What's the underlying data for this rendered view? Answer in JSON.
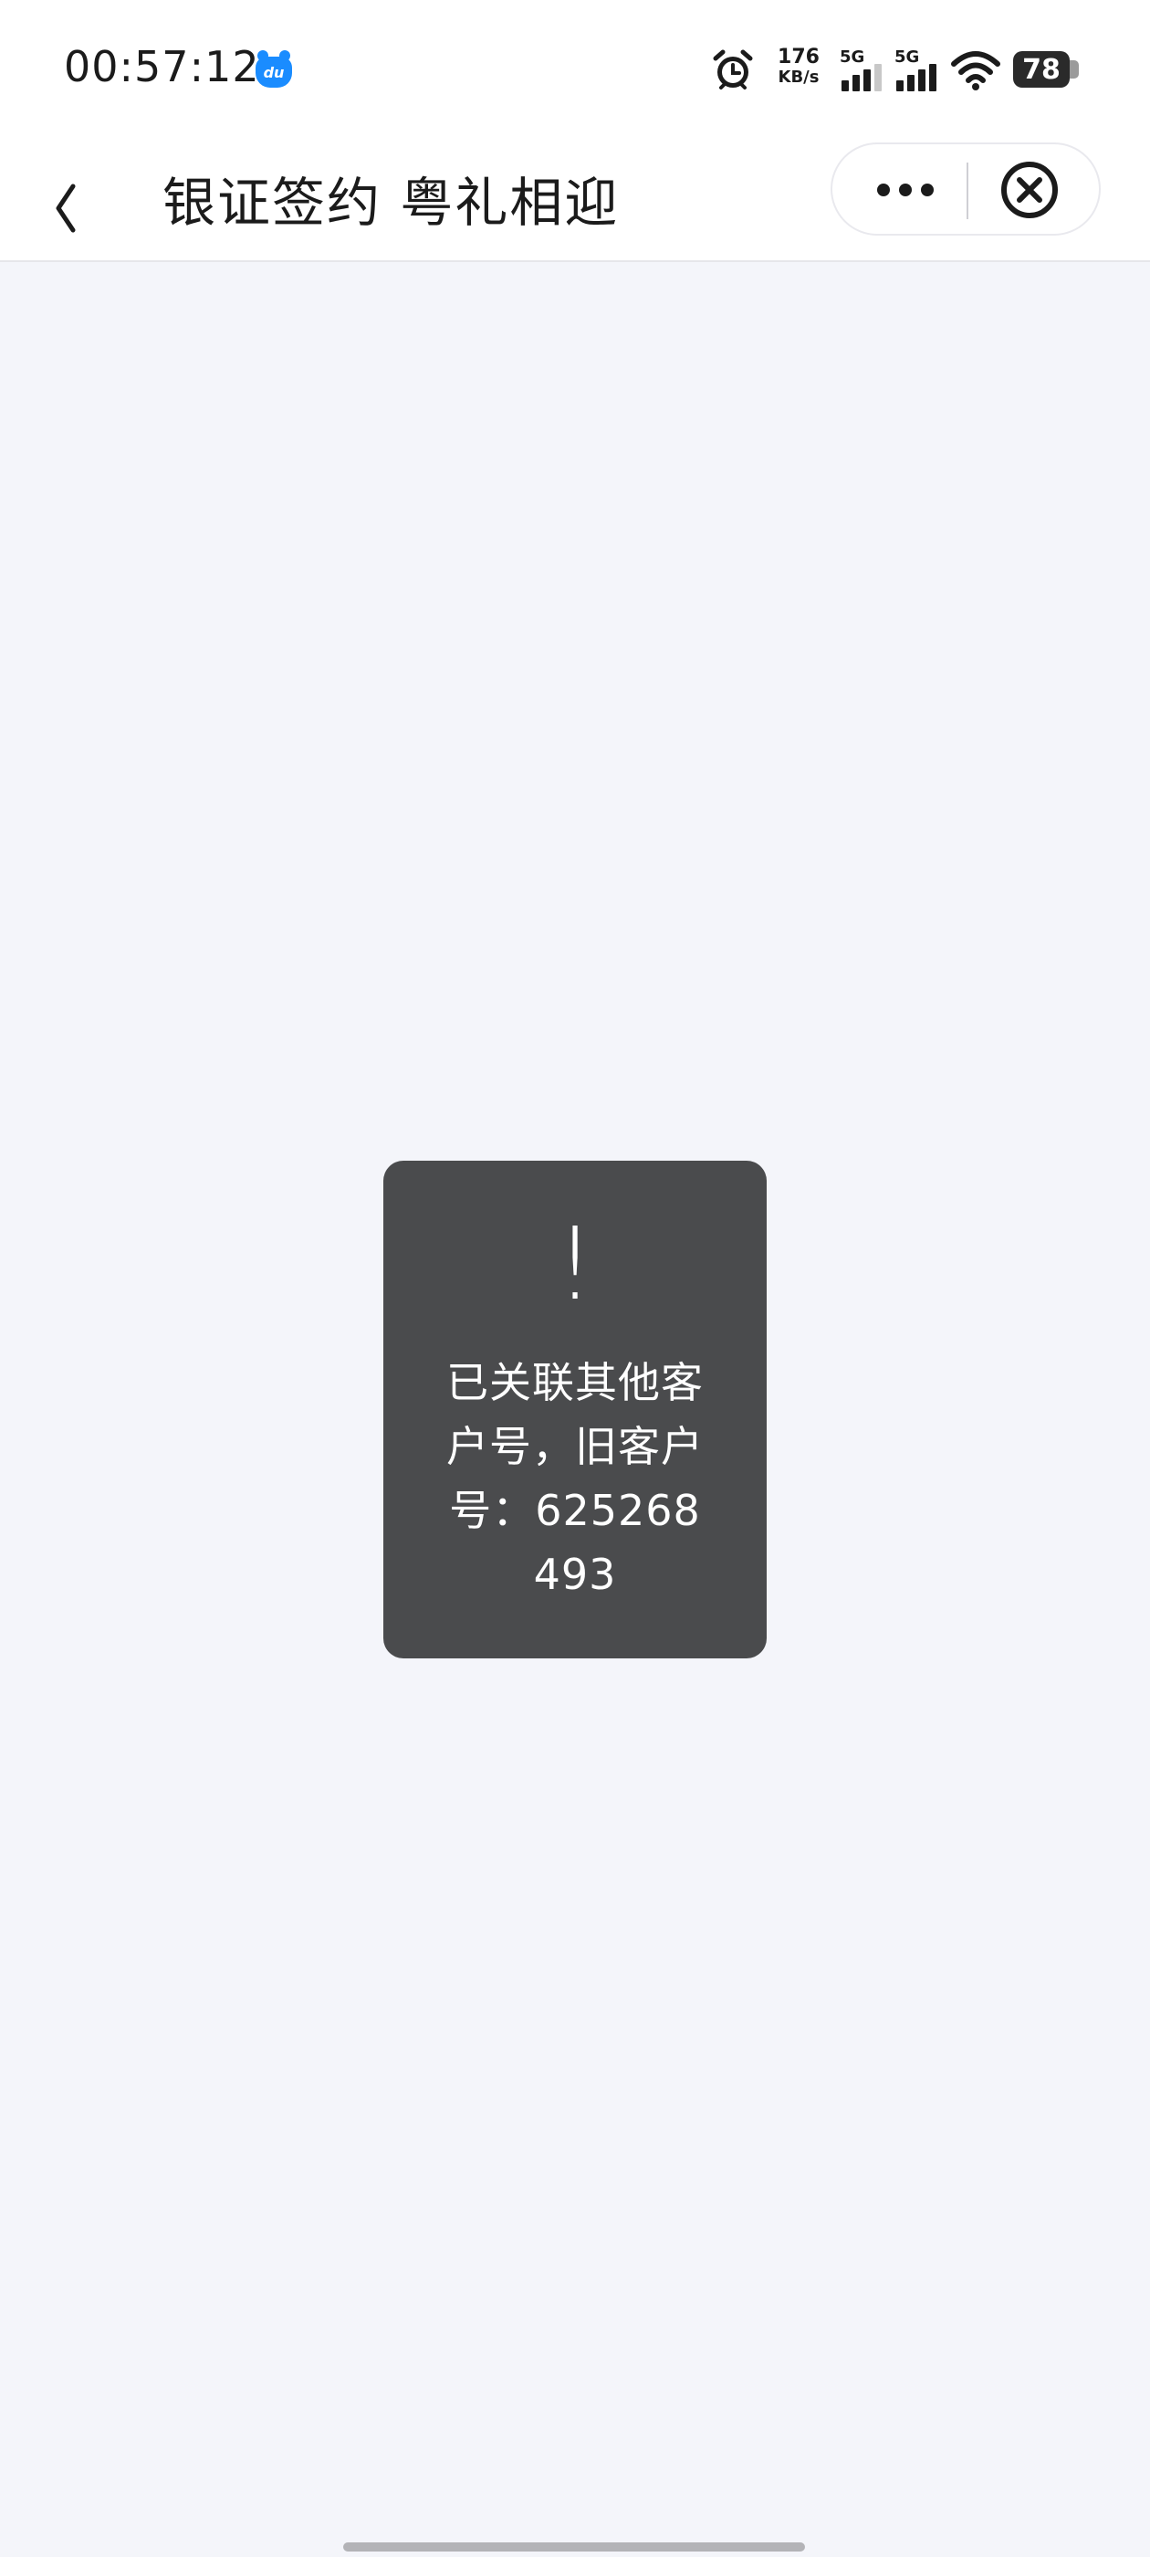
{
  "status_bar": {
    "time": "00:57:12",
    "app_badge": "du",
    "net_speed_value": "176",
    "net_speed_unit": "KB/s",
    "sim1_label": "5G",
    "sim2_label": "5G",
    "battery_level": "78"
  },
  "nav": {
    "title": "银证签约 粤礼相迎",
    "back_icon": "chevron-left-icon",
    "more_icon": "more-dots-icon",
    "close_icon": "close-circle-icon"
  },
  "toast": {
    "icon": "!",
    "message": "已关联其他客户号，旧客户号：625268493"
  },
  "colors": {
    "page_background": "#f4f5fa",
    "toast_background": "#4a4b4d",
    "badge_blue": "#1a8cff"
  }
}
